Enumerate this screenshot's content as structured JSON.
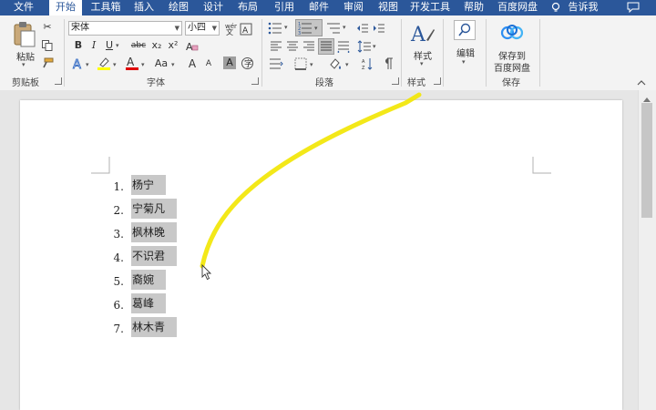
{
  "tabs": [
    "文件",
    "开始",
    "工具箱",
    "插入",
    "绘图",
    "设计",
    "布局",
    "引用",
    "邮件",
    "审阅",
    "视图",
    "开发工具",
    "帮助",
    "百度网盘",
    "告诉我"
  ],
  "active_tab": "开始",
  "clipboard": {
    "paste_label": "粘贴",
    "group_label": "剪贴板"
  },
  "font": {
    "family": "宋体",
    "size": "小四",
    "group_label": "字体",
    "bold": "B",
    "italic": "I",
    "underline": "U",
    "strike": "abc",
    "subscript": "x₂",
    "superscript": "x²",
    "grow": "A",
    "shrink": "A",
    "change_case": "Aa",
    "clear_format": "A",
    "char_shade": "A",
    "highlight_color": "#ffff00",
    "font_color": "#e00000"
  },
  "paragraph": {
    "group_label": "段落"
  },
  "styles": {
    "label": "样式",
    "group_label": "样式"
  },
  "editing": {
    "label": "编辑"
  },
  "baidu": {
    "label_line1": "保存到",
    "label_line2": "百度网盘",
    "group_label": "保存"
  },
  "list": {
    "items": [
      {
        "num": "1.",
        "text": "杨宁"
      },
      {
        "num": "2.",
        "text": "宁菊凡"
      },
      {
        "num": "3.",
        "text": "枫林晚"
      },
      {
        "num": "4.",
        "text": "不识君"
      },
      {
        "num": "5.",
        "text": "裔婉"
      },
      {
        "num": "6.",
        "text": "葛峰"
      },
      {
        "num": "7.",
        "text": "林木青"
      }
    ]
  },
  "colors": {
    "title_bar": "#2b579a",
    "ribbon": "#f3f3f3",
    "selection": "#c8c8c8",
    "pen_stroke": "#f2e600"
  }
}
